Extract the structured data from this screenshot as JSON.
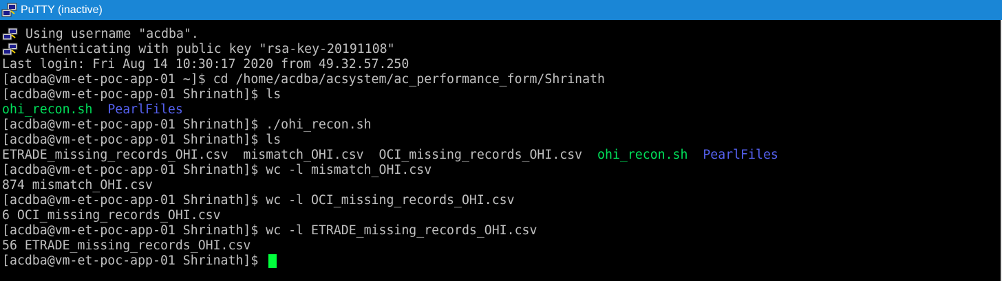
{
  "window": {
    "title": "PuTTY (inactive)",
    "icon": "putty-icon"
  },
  "colors": {
    "titlebar": "#1a86d6",
    "background": "#000000",
    "text": "#c0c0c0",
    "green": "#00e05a",
    "blue": "#5561f0",
    "cursor": "#00ff3c"
  },
  "terminal": {
    "lines": [
      {
        "icon": "putty-icon",
        "segments": [
          {
            "text": "Using username \"acdba\".",
            "color": "default"
          }
        ]
      },
      {
        "icon": "putty-icon",
        "segments": [
          {
            "text": "Authenticating with public key \"rsa-key-20191108\"",
            "color": "default"
          }
        ]
      },
      {
        "segments": [
          {
            "text": "Last login: Fri Aug 14 10:30:17 2020 from 49.32.57.250",
            "color": "default"
          }
        ]
      },
      {
        "segments": [
          {
            "text": "[acdba@vm-et-poc-app-01 ~]$ cd /home/acdba/acsystem/ac_performance_form/Shrinath",
            "color": "default"
          }
        ]
      },
      {
        "segments": [
          {
            "text": "[acdba@vm-et-poc-app-01 Shrinath]$ ls",
            "color": "default"
          }
        ]
      },
      {
        "segments": [
          {
            "text": "ohi_recon.sh",
            "color": "green"
          },
          {
            "text": "  ",
            "color": "default"
          },
          {
            "text": "PearlFiles",
            "color": "blue"
          }
        ]
      },
      {
        "segments": [
          {
            "text": "[acdba@vm-et-poc-app-01 Shrinath]$ ./ohi_recon.sh",
            "color": "default"
          }
        ]
      },
      {
        "segments": [
          {
            "text": "[acdba@vm-et-poc-app-01 Shrinath]$ ls",
            "color": "default"
          }
        ]
      },
      {
        "segments": [
          {
            "text": "ETRADE_missing_records_OHI.csv  mismatch_OHI.csv  OCI_missing_records_OHI.csv  ",
            "color": "default"
          },
          {
            "text": "ohi_recon.sh",
            "color": "green"
          },
          {
            "text": "  ",
            "color": "default"
          },
          {
            "text": "PearlFiles",
            "color": "blue"
          }
        ]
      },
      {
        "segments": [
          {
            "text": "[acdba@vm-et-poc-app-01 Shrinath]$ wc -l mismatch_OHI.csv",
            "color": "default"
          }
        ]
      },
      {
        "segments": [
          {
            "text": "874 mismatch_OHI.csv",
            "color": "default"
          }
        ]
      },
      {
        "segments": [
          {
            "text": "[acdba@vm-et-poc-app-01 Shrinath]$ wc -l OCI_missing_records_OHI.csv",
            "color": "default"
          }
        ]
      },
      {
        "segments": [
          {
            "text": "6 OCI_missing_records_OHI.csv",
            "color": "default"
          }
        ]
      },
      {
        "segments": [
          {
            "text": "[acdba@vm-et-poc-app-01 Shrinath]$ wc -l ETRADE_missing_records_OHI.csv",
            "color": "default"
          }
        ]
      },
      {
        "segments": [
          {
            "text": "56 ETRADE_missing_records_OHI.csv",
            "color": "default"
          }
        ]
      },
      {
        "segments": [
          {
            "text": "[acdba@vm-et-poc-app-01 Shrinath]$ ",
            "color": "default"
          }
        ],
        "cursor": true
      }
    ]
  }
}
